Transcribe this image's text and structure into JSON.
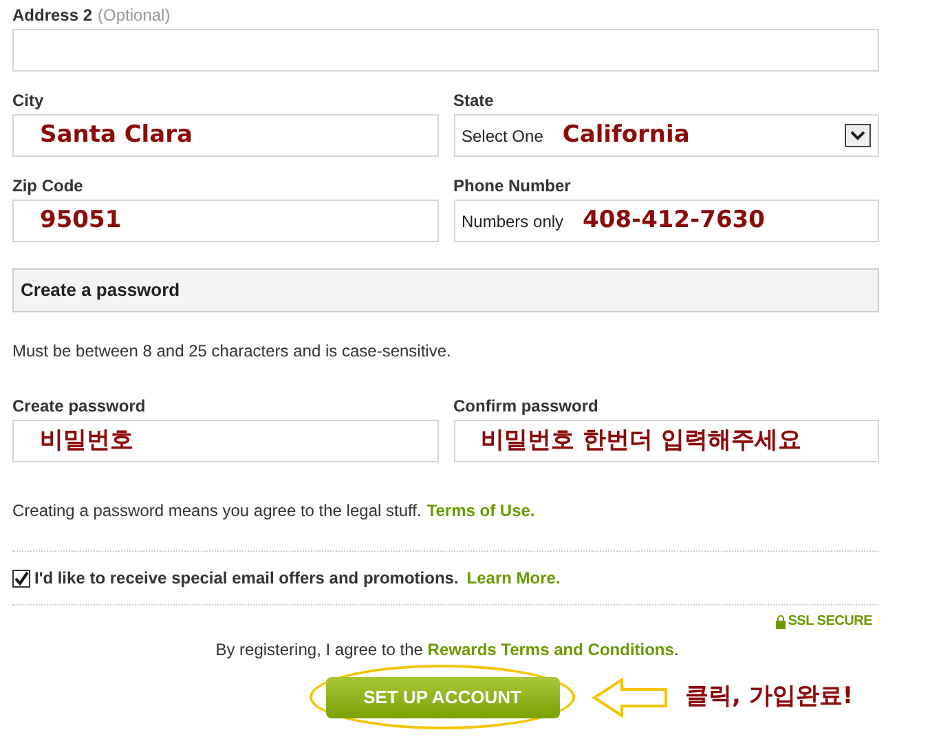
{
  "address2": {
    "label": "Address 2",
    "optional": "(Optional)"
  },
  "city": {
    "label": "City",
    "value": "Santa Clara"
  },
  "state": {
    "label": "State",
    "hint": "Select One",
    "value": "California"
  },
  "zip": {
    "label": "Zip Code",
    "value": "95051"
  },
  "phone": {
    "label": "Phone Number",
    "hint": "Numbers only",
    "value": "408-412-7630"
  },
  "password_section": {
    "title": "Create a password",
    "note": "Must be between 8 and 25 characters and is case-sensitive."
  },
  "create_password": {
    "label": "Create password",
    "value": "비밀번호"
  },
  "confirm_password": {
    "label": "Confirm password",
    "value": "비밀번호 한번더 입력해주세요"
  },
  "legal": {
    "text": "Creating a password means you agree to the legal stuff.",
    "link": "Terms of Use."
  },
  "offers": {
    "checked": true,
    "text": "I'd like to receive special email offers and promotions.",
    "link": "Learn More."
  },
  "ssl": "SSL SECURE",
  "register": {
    "text": "By registering, I agree to the",
    "link": "Rewards Terms and Conditions",
    "end": "."
  },
  "button": "SET UP ACCOUNT",
  "annotation": "클릭, 가입완료!"
}
